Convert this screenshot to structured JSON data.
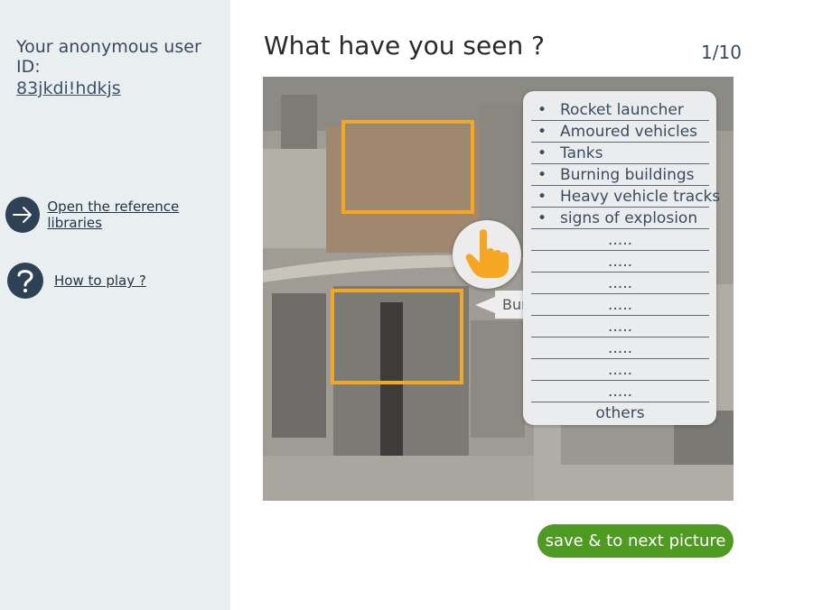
{
  "sidebar": {
    "user_id_label": "Your anonymous user ID:",
    "user_id_value": "83jkdi!hdkjs",
    "links": [
      {
        "label": "Open the reference libraries",
        "icon": "arrow-right-icon"
      },
      {
        "label": "How to play ?",
        "icon": "question-icon"
      }
    ]
  },
  "main": {
    "title": "What have you seen ?",
    "counter": "1/10",
    "tooltip_text": "Bur",
    "save_button": "save &  to next picture"
  },
  "options_panel": {
    "items": [
      "Rocket launcher",
      "Amoured vehicles",
      "Tanks",
      "Burning buildings",
      "Heavy vehicle tracks",
      "signs of explosion"
    ],
    "blank_placeholder": ".....",
    "blank_count": 8,
    "others_label": "others",
    "bullet": "•"
  },
  "colors": {
    "sidebar_bg": "#e9eef0",
    "accent_orange": "#f5a623",
    "button_green": "#4e9a22",
    "icon_navy": "#2f4154"
  }
}
